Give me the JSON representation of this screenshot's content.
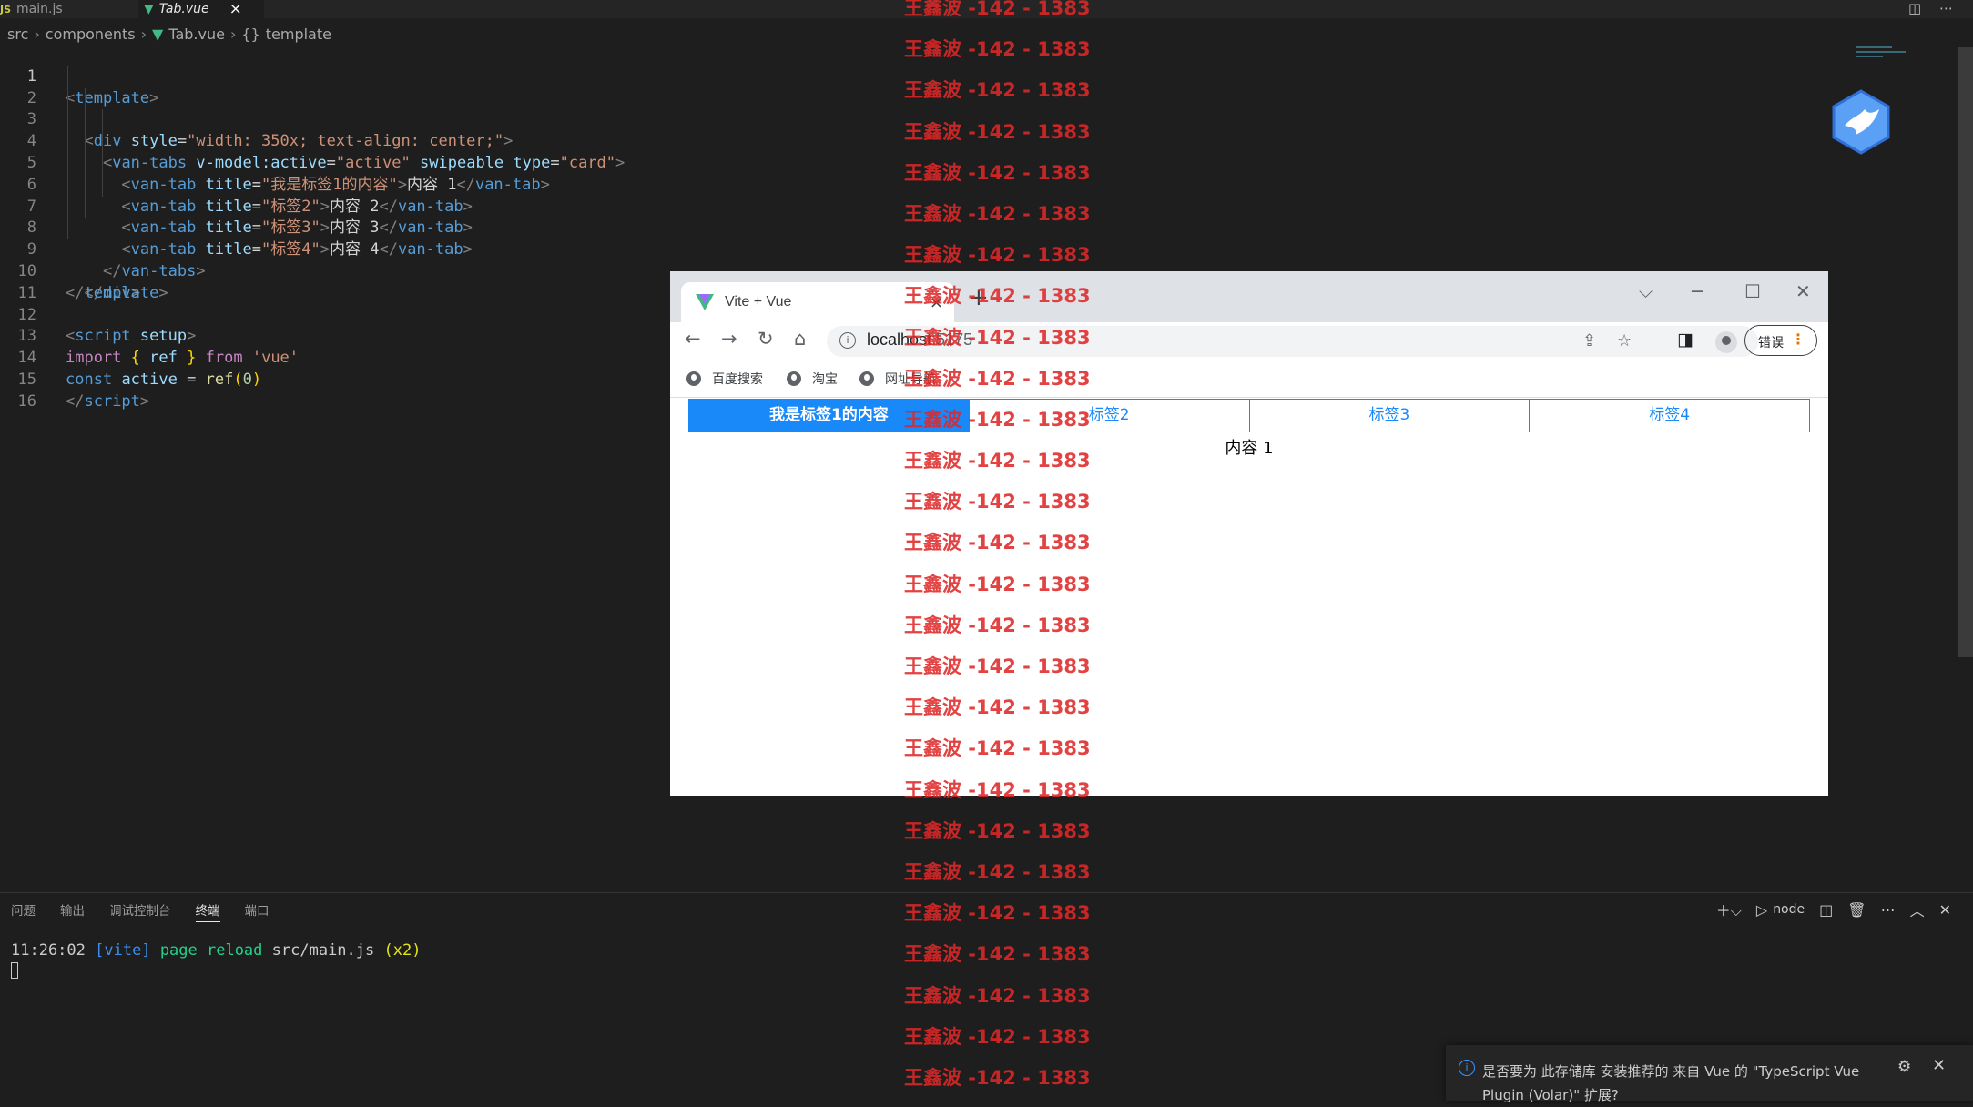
{
  "editor_tabs": [
    {
      "label": "main.js",
      "icon": "js-file-icon"
    },
    {
      "label": "Tab.vue",
      "icon": "vue-file-icon",
      "active": true
    }
  ],
  "breadcrumb": {
    "src": "src",
    "components": "components",
    "file": "Tab.vue",
    "symbol_icon": "{}",
    "symbol": "template"
  },
  "line_numbers": [
    "1",
    "2",
    "3",
    "4",
    "5",
    "6",
    "7",
    "8",
    "9",
    "10",
    "11",
    "12",
    "13",
    "14",
    "15",
    "16"
  ],
  "code": {
    "l1": {
      "open": "<",
      "tag": "template",
      "close": ">"
    },
    "l2": {
      "open": "<",
      "tag": "div",
      "attr": "style",
      "eq": "=",
      "val": "\"width: 350x; text-align: center;\"",
      "close": ">"
    },
    "l3": {
      "open": "<",
      "tag": "van-tabs",
      "attr1": "v-model:active",
      "eq": "=",
      "val1": "\"active\"",
      "attr2": "swipeable",
      "attr3": "type",
      "val3": "\"card\"",
      "close": ">"
    },
    "l4": {
      "open": "<",
      "tag": "van-tab",
      "attr": "title",
      "eq": "=",
      "val": "\"我是标签1的内容\"",
      "gt": ">",
      "text": "内容 1",
      "endopen": "</",
      "endclose": ">"
    },
    "l5": {
      "open": "<",
      "tag": "van-tab",
      "attr": "title",
      "eq": "=",
      "val": "\"标签2\"",
      "gt": ">",
      "text": "内容 2",
      "endopen": "</",
      "endclose": ">"
    },
    "l6": {
      "open": "<",
      "tag": "van-tab",
      "attr": "title",
      "eq": "=",
      "val": "\"标签3\"",
      "gt": ">",
      "text": "内容 3",
      "endopen": "</",
      "endclose": ">"
    },
    "l7": {
      "open": "<",
      "tag": "van-tab",
      "attr": "title",
      "eq": "=",
      "val": "\"标签4\"",
      "gt": ">",
      "text": "内容 4",
      "endopen": "</",
      "endclose": ">"
    },
    "l8": {
      "open": "</",
      "tag": "van-tabs",
      "close": ">"
    },
    "l9": {
      "open": "</",
      "tag": "div",
      "close": ">"
    },
    "l10": {
      "open": "</",
      "tag": "template",
      "close": ">"
    },
    "l12": {
      "open": "<",
      "tag": "script",
      "attr": "setup",
      "close": ">"
    },
    "l13": {
      "kw1": "import",
      "lb": "{",
      "name": "ref",
      "rb": "}",
      "kw2": "from",
      "str": "'vue'"
    },
    "l14": {
      "kw": "const",
      "name": "active",
      "eq": "=",
      "fn": "ref",
      "lp": "(",
      "num": "0",
      "rp": ")"
    },
    "l15": {
      "open": "</",
      "tag": "script",
      "close": ">"
    }
  },
  "browser": {
    "tab_title": "Vite + Vue",
    "tab_close": "×",
    "new_tab": "+",
    "url_host": "localhost",
    "url_port": ":5175",
    "error_button": "错误",
    "bookmarks": [
      "百度搜索",
      "淘宝",
      "网址导航"
    ],
    "window_controls": {
      "dropdown": "⌵",
      "minimize": "─",
      "maximize": "☐",
      "close": "✕"
    }
  },
  "van_tabs": {
    "tabs": [
      {
        "title": "我是标签1的内容",
        "active": true
      },
      {
        "title": "标签2"
      },
      {
        "title": "标签3"
      },
      {
        "title": "标签4"
      }
    ],
    "content": "内容 1",
    "active_color": "#1989fa"
  },
  "panel": {
    "tabs": [
      "问题",
      "输出",
      "调试控制台",
      "终端",
      "端口"
    ],
    "active_tab": "终端",
    "shell_label": "node",
    "terminal": {
      "time": "11:26:02",
      "tag": "[vite]",
      "msg": "page reload",
      "path": "src/main.js",
      "count": "(x2)"
    }
  },
  "notification": {
    "message": "是否要为 此存储库 安装推荐的 来自 Vue 的 \"TypeScript Vue Plugin (Volar)\" 扩展?",
    "close": "✕"
  },
  "watermark": {
    "text": "王鑫波 -142 - 1383",
    "lines": [
      "王鑫波 -142 - 1383",
      "王鑫波 -142 - 1383",
      "王鑫波 -142 - 1383",
      "王鑫波 -142 - 1383",
      "王鑫波 -142 - 1383",
      "王鑫波 -142 - 1383",
      "王鑫波 -142 - 1383",
      "王鑫波 -142 - 1383",
      "王鑫波 -142 - 1383",
      "王鑫波 -142 - 1383",
      "王鑫波 -142 - 1383",
      "王鑫波 -142 - 1383",
      "王鑫波 -142 - 1383",
      "王鑫波 -142 - 1383",
      "王鑫波 -142 - 1383",
      "王鑫波 -142 - 1383",
      "王鑫波 -142 - 1383",
      "王鑫波 -142 - 1383",
      "王鑫波 -142 - 1383",
      "王鑫波 -142 - 1383",
      "王鑫波 -142 - 1383",
      "王鑫波 -142 - 1383",
      "王鑫波 -142 - 1383",
      "王鑫波 -142 - 1383",
      "王鑫波 -142 - 1383",
      "王鑫波 -142 - 1383",
      "王鑫波 -142 - 1383"
    ],
    "color": "#de2828"
  },
  "colors": {
    "editor_bg": "#1e1e1e",
    "vue_green": "#42b883",
    "vant_blue": "#1989fa"
  }
}
